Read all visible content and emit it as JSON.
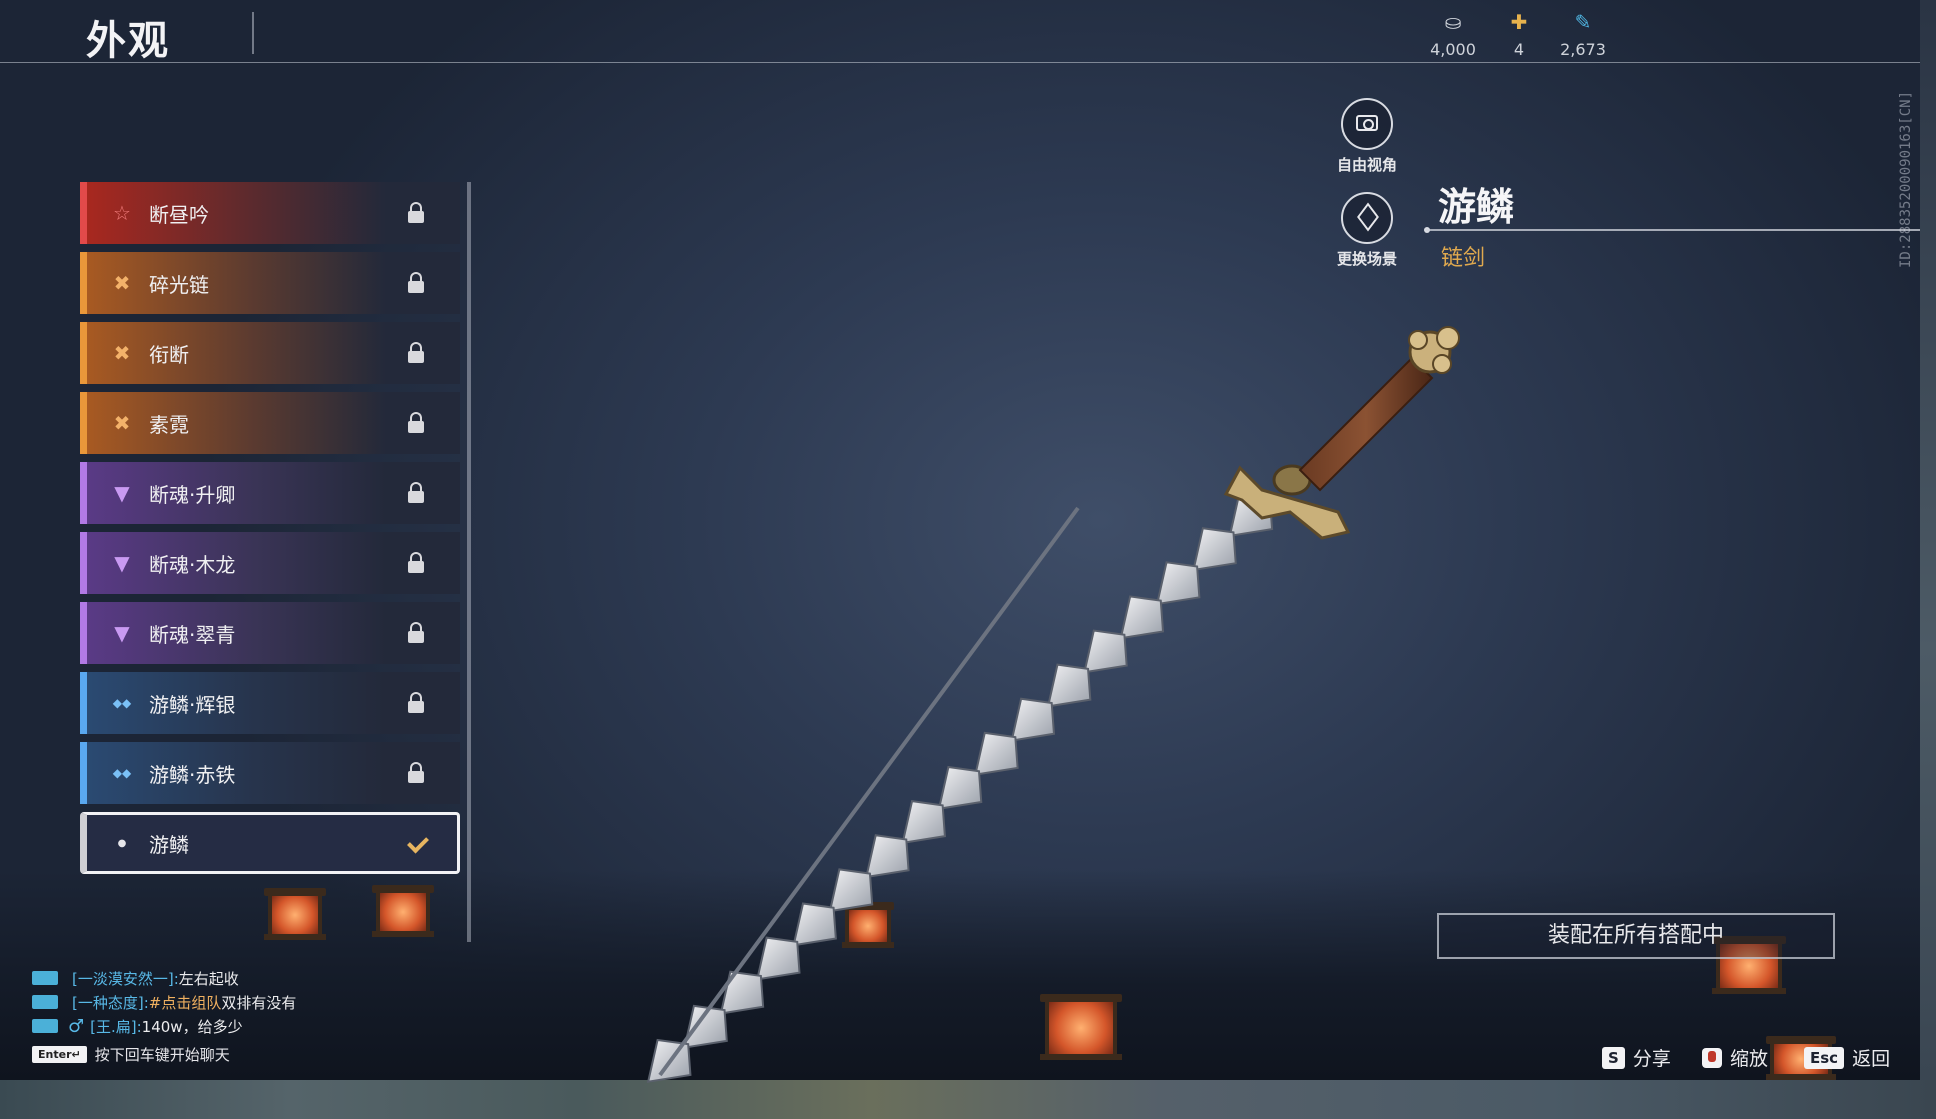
{
  "header": {
    "title": "外观",
    "currencies": [
      {
        "icon": "coin-icon",
        "glyph": "⛀",
        "value": "4,000",
        "color": "#cfd3da"
      },
      {
        "icon": "ticket-icon",
        "glyph": "✚",
        "value": "4",
        "color": "#e7b24d"
      },
      {
        "icon": "feather-icon",
        "glyph": "✎",
        "value": "2,673",
        "color": "#4fb4e0"
      }
    ]
  },
  "build_id": "ID:28835200090163[CN]",
  "skins": [
    {
      "name": "断昼吟",
      "rarity_glyph": "☆",
      "rarity_color": "#e24a4a",
      "locked": true
    },
    {
      "name": "碎光链",
      "rarity_glyph": "✖",
      "rarity_color": "#e9973a",
      "locked": true
    },
    {
      "name": "衔断",
      "rarity_glyph": "✖",
      "rarity_color": "#e9973a",
      "locked": true
    },
    {
      "name": "素霓",
      "rarity_glyph": "✖",
      "rarity_color": "#e9973a",
      "locked": true
    },
    {
      "name": "断魂·升卿",
      "rarity_glyph": "▼",
      "rarity_color": "#b27ae6",
      "locked": true
    },
    {
      "name": "断魂·木龙",
      "rarity_glyph": "▼",
      "rarity_color": "#b27ae6",
      "locked": true
    },
    {
      "name": "断魂·翠青",
      "rarity_glyph": "▼",
      "rarity_color": "#b27ae6",
      "locked": true
    },
    {
      "name": "游鳞·辉银",
      "rarity_glyph": "◆◆",
      "rarity_color": "#5aa8f0",
      "locked": true
    },
    {
      "name": "游鳞·赤铁",
      "rarity_glyph": "◆◆",
      "rarity_color": "#5aa8f0",
      "locked": true
    },
    {
      "name": "游鳞",
      "rarity_glyph": "●",
      "rarity_color": "#e6e6ea",
      "locked": false,
      "selected": true
    }
  ],
  "camera": {
    "free_view_label": "自由视角",
    "change_scene_label": "更换场景"
  },
  "item": {
    "name": "游鳞",
    "type": "链剑"
  },
  "equip_button_label": "装配在所有搭配中",
  "chat": {
    "lines": [
      {
        "name": "[一淡漠安然一]:",
        "highlight": "",
        "message": "左右起收",
        "male": false
      },
      {
        "name": "[一种态度]:",
        "highlight": "#点击组队",
        "message": " 双排有没有",
        "male": false
      },
      {
        "name": "[王.扁]:",
        "highlight": "",
        "message": "140w，给多少",
        "male": true
      }
    ],
    "enter_key": "Enter↵",
    "hint": "按下回车键开始聊天"
  },
  "hotkeys": {
    "share_key": "S",
    "share_label": "分享",
    "zoom_label": "缩放",
    "back_key": "Esc",
    "back_label": "返回"
  }
}
